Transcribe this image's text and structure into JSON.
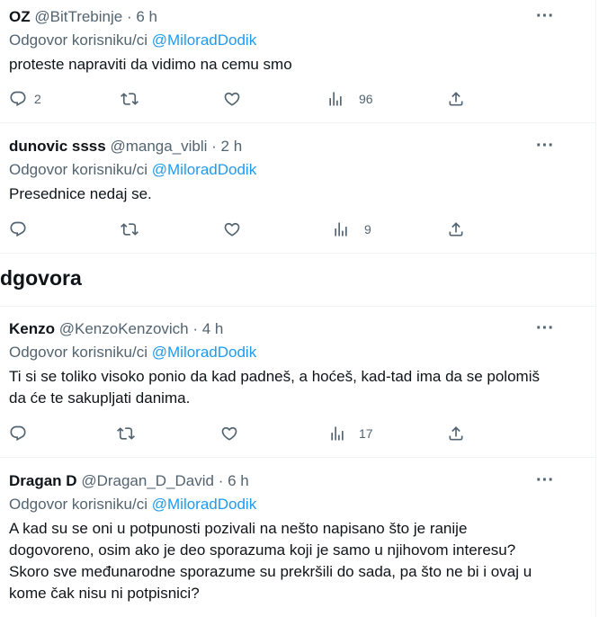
{
  "tweets": [
    {
      "name": "OZ",
      "handle": "@BitTrebinje",
      "time": "· 6 h",
      "reply_prefix": "Odgovor korisniku/ci",
      "reply_to": "@MiloradDodik",
      "text": "proteste napraviti da vidimo na cemu smo",
      "replies": "2",
      "retweets": "",
      "likes": "",
      "views": "96"
    },
    {
      "name": "dunovic ssss",
      "handle": "@manga_vibli",
      "time": "· 2 h",
      "reply_prefix": "Odgovor korisniku/ci",
      "reply_to": "@MiloradDodik",
      "text": "Presednice nedaj se.",
      "replies": "",
      "retweets": "",
      "likes": "",
      "views": "9"
    },
    {
      "name": "Kenzo",
      "handle": "@KenzoKenzovich",
      "time": "· 4 h",
      "reply_prefix": "Odgovor korisniku/ci",
      "reply_to": "@MiloradDodik",
      "text": "Ti si se toliko visoko ponio da kad padneš, a hoćeš, kad-tad ima da se polomiš da će te sakupljati danima.",
      "replies": "",
      "retweets": "",
      "likes": "",
      "views": "17"
    },
    {
      "name": "Dragan D",
      "handle": "@Dragan_D_David",
      "time": "· 6 h",
      "reply_prefix": "Odgovor korisniku/ci",
      "reply_to": "@MiloradDodik",
      "text": "A kad su se oni u potpunosti pozivali na nešto napisano što je ranije dogovoreno, osim ako je deo sporazuma koji je samo u njihovom interesu? Skoro sve međunarodne sporazume su prekršili do sada, pa što ne bi i ovaj u kome čak nisu ni potpisnici?"
    }
  ],
  "section_title": "dgovora",
  "icons": {
    "reply": "reply-icon",
    "retweet": "retweet-icon",
    "like": "heart-icon",
    "views": "views-icon",
    "share": "share-icon",
    "more": "more-icon"
  },
  "colors": {
    "accent": "#1d9bf0",
    "muted": "#536471",
    "text": "#0f1419",
    "border": "#eff3f4"
  }
}
